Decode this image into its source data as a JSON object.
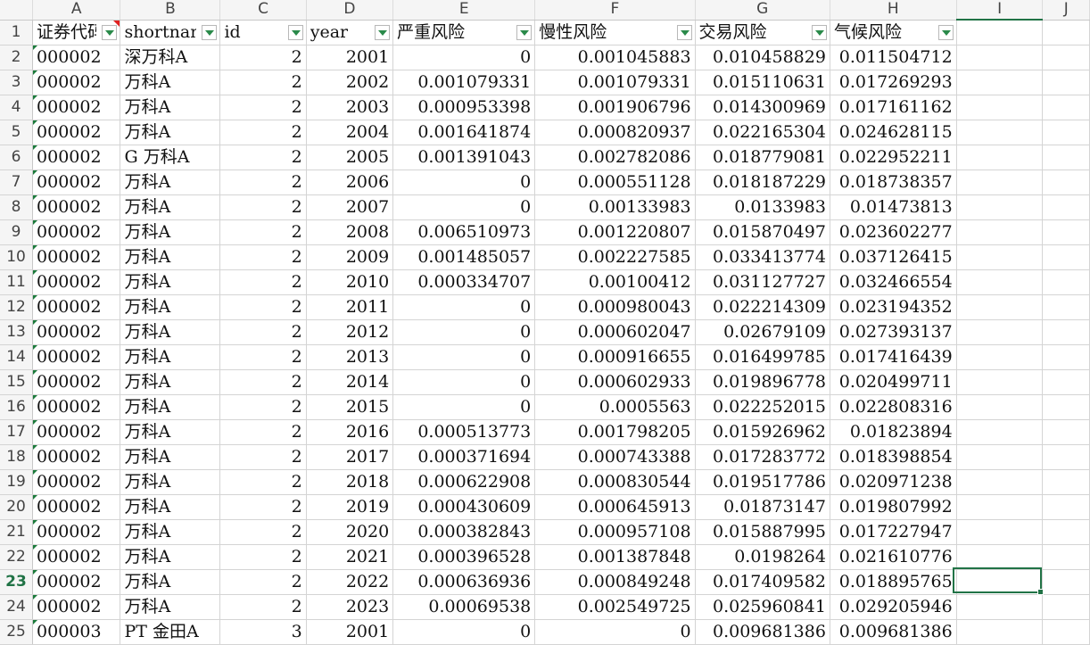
{
  "columns": [
    "",
    "A",
    "B",
    "C",
    "D",
    "E",
    "F",
    "G",
    "H",
    "I",
    "J"
  ],
  "selected_column": "I",
  "selected_row": "23",
  "header_row": {
    "row_number": "1",
    "cells": [
      "证券代码",
      "shortname",
      "id",
      "year",
      "严重风险",
      "慢性风险",
      "交易风险",
      "气候风险"
    ]
  },
  "rows": [
    {
      "n": "2",
      "code": "000002",
      "name": "深万科A",
      "id": "2",
      "year": "2001",
      "e": "0",
      "f": "0.001045883",
      "g": "0.010458829",
      "h": "0.011504712"
    },
    {
      "n": "3",
      "code": "000002",
      "name": "万科A",
      "id": "2",
      "year": "2002",
      "e": "0.001079331",
      "f": "0.001079331",
      "g": "0.015110631",
      "h": "0.017269293"
    },
    {
      "n": "4",
      "code": "000002",
      "name": "万科A",
      "id": "2",
      "year": "2003",
      "e": "0.000953398",
      "f": "0.001906796",
      "g": "0.014300969",
      "h": "0.017161162"
    },
    {
      "n": "5",
      "code": "000002",
      "name": "万科A",
      "id": "2",
      "year": "2004",
      "e": "0.001641874",
      "f": "0.000820937",
      "g": "0.022165304",
      "h": "0.024628115"
    },
    {
      "n": "6",
      "code": "000002",
      "name": "G 万科A",
      "id": "2",
      "year": "2005",
      "e": "0.001391043",
      "f": "0.002782086",
      "g": "0.018779081",
      "h": "0.022952211"
    },
    {
      "n": "7",
      "code": "000002",
      "name": "万科A",
      "id": "2",
      "year": "2006",
      "e": "0",
      "f": "0.000551128",
      "g": "0.018187229",
      "h": "0.018738357"
    },
    {
      "n": "8",
      "code": "000002",
      "name": "万科A",
      "id": "2",
      "year": "2007",
      "e": "0",
      "f": "0.00133983",
      "g": "0.0133983",
      "h": "0.01473813"
    },
    {
      "n": "9",
      "code": "000002",
      "name": "万科A",
      "id": "2",
      "year": "2008",
      "e": "0.006510973",
      "f": "0.001220807",
      "g": "0.015870497",
      "h": "0.023602277"
    },
    {
      "n": "10",
      "code": "000002",
      "name": "万科A",
      "id": "2",
      "year": "2009",
      "e": "0.001485057",
      "f": "0.002227585",
      "g": "0.033413774",
      "h": "0.037126415"
    },
    {
      "n": "11",
      "code": "000002",
      "name": "万科A",
      "id": "2",
      "year": "2010",
      "e": "0.000334707",
      "f": "0.00100412",
      "g": "0.031127727",
      "h": "0.032466554"
    },
    {
      "n": "12",
      "code": "000002",
      "name": "万科A",
      "id": "2",
      "year": "2011",
      "e": "0",
      "f": "0.000980043",
      "g": "0.022214309",
      "h": "0.023194352"
    },
    {
      "n": "13",
      "code": "000002",
      "name": "万科A",
      "id": "2",
      "year": "2012",
      "e": "0",
      "f": "0.000602047",
      "g": "0.02679109",
      "h": "0.027393137"
    },
    {
      "n": "14",
      "code": "000002",
      "name": "万科A",
      "id": "2",
      "year": "2013",
      "e": "0",
      "f": "0.000916655",
      "g": "0.016499785",
      "h": "0.017416439"
    },
    {
      "n": "15",
      "code": "000002",
      "name": "万科A",
      "id": "2",
      "year": "2014",
      "e": "0",
      "f": "0.000602933",
      "g": "0.019896778",
      "h": "0.020499711"
    },
    {
      "n": "16",
      "code": "000002",
      "name": "万科A",
      "id": "2",
      "year": "2015",
      "e": "0",
      "f": "0.0005563",
      "g": "0.022252015",
      "h": "0.022808316"
    },
    {
      "n": "17",
      "code": "000002",
      "name": "万科A",
      "id": "2",
      "year": "2016",
      "e": "0.000513773",
      "f": "0.001798205",
      "g": "0.015926962",
      "h": "0.01823894"
    },
    {
      "n": "18",
      "code": "000002",
      "name": "万科A",
      "id": "2",
      "year": "2017",
      "e": "0.000371694",
      "f": "0.000743388",
      "g": "0.017283772",
      "h": "0.018398854"
    },
    {
      "n": "19",
      "code": "000002",
      "name": "万科A",
      "id": "2",
      "year": "2018",
      "e": "0.000622908",
      "f": "0.000830544",
      "g": "0.019517786",
      "h": "0.020971238"
    },
    {
      "n": "20",
      "code": "000002",
      "name": "万科A",
      "id": "2",
      "year": "2019",
      "e": "0.000430609",
      "f": "0.000645913",
      "g": "0.01873147",
      "h": "0.019807992"
    },
    {
      "n": "21",
      "code": "000002",
      "name": "万科A",
      "id": "2",
      "year": "2020",
      "e": "0.000382843",
      "f": "0.000957108",
      "g": "0.015887995",
      "h": "0.017227947"
    },
    {
      "n": "22",
      "code": "000002",
      "name": "万科A",
      "id": "2",
      "year": "2021",
      "e": "0.000396528",
      "f": "0.001387848",
      "g": "0.0198264",
      "h": "0.021610776"
    },
    {
      "n": "23",
      "code": "000002",
      "name": "万科A",
      "id": "2",
      "year": "2022",
      "e": "0.000636936",
      "f": "0.000849248",
      "g": "0.017409582",
      "h": "0.018895765"
    },
    {
      "n": "24",
      "code": "000002",
      "name": "万科A",
      "id": "2",
      "year": "2023",
      "e": "0.00069538",
      "f": "0.002549725",
      "g": "0.025960841",
      "h": "0.029205946"
    },
    {
      "n": "25",
      "code": "000003",
      "name": "PT 金田A",
      "id": "3",
      "year": "2001",
      "e": "0",
      "f": "0",
      "g": "0.009681386",
      "h": "0.009681386"
    }
  ],
  "colors": {
    "accent": "#217346",
    "comment_marker": "#e02020",
    "grid": "#d4d4d4"
  }
}
